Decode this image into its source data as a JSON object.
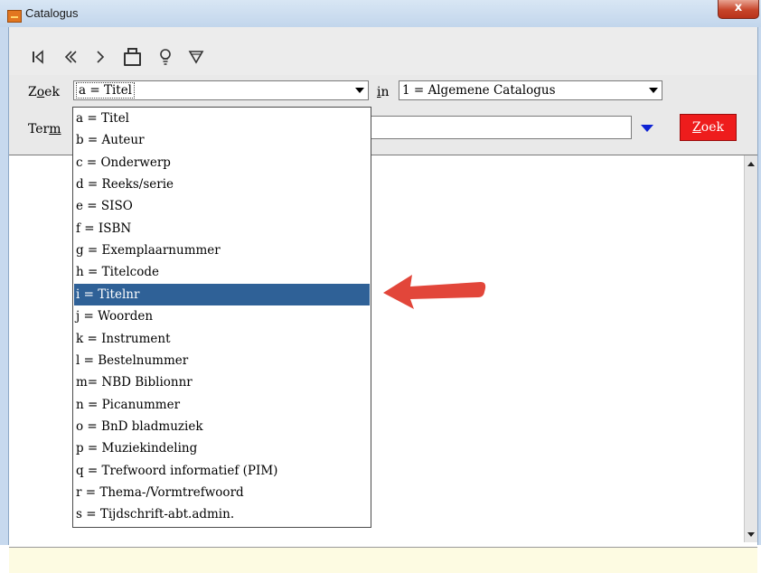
{
  "window": {
    "title": "Catalogus",
    "close_label": "x"
  },
  "toolbar": {
    "icons": [
      "first-record-icon",
      "previous-icon",
      "next-icon",
      "bag-icon",
      "lightbulb-icon",
      "filter-icon"
    ]
  },
  "form": {
    "zoek_label_pre": "Z",
    "zoek_label_u": "o",
    "zoek_label_post": "ek",
    "field_value": "a = Titel",
    "in_label_u": "i",
    "in_label_post": "n",
    "catalog_value": "1 = Algemene Catalogus",
    "term_label_pre": "Ter",
    "term_label_u": "m",
    "term_value": "",
    "search_button_u": "Z",
    "search_button_post": "oek"
  },
  "dropdown": {
    "items": [
      "a = Titel",
      "b = Auteur",
      "c = Onderwerp",
      "d = Reeks/serie",
      "e = SISO",
      "f = ISBN",
      "g = Exemplaarnummer",
      "h = Titelcode",
      "i  = Titelnr",
      "j  = Woorden",
      "k = Instrument",
      "l  = Bestelnummer",
      "m= NBD Biblionnr",
      "n = Picanummer",
      "o = BnD bladmuziek",
      "p = Muziekindeling",
      "q = Trefwoord informatief (PIM)",
      "r = Thema-/Vormtrefwoord",
      "s = Tijdschrift-abt.admin."
    ],
    "selected_index": 8
  },
  "colors": {
    "search_button": "#ee1c1c",
    "selection": "#2f6197",
    "annotation_arrow": "#e2463a",
    "statusbar": "#fdfbe2"
  }
}
